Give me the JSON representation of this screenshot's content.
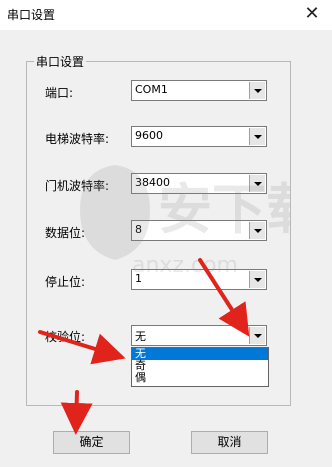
{
  "window": {
    "title": "串口设置",
    "close_glyph": "✕"
  },
  "group": {
    "title": "串口设置"
  },
  "fields": [
    {
      "label": "端口:",
      "value": "COM1"
    },
    {
      "label": "电梯波特率:",
      "value": "9600"
    },
    {
      "label": "门机波特率:",
      "value": "38400"
    },
    {
      "label": "数据位:",
      "value": "8"
    },
    {
      "label": "停止位:",
      "value": "1"
    },
    {
      "label": "校验位:",
      "value": "无"
    }
  ],
  "parity_options": [
    "无",
    "奇",
    "偶"
  ],
  "buttons": {
    "ok": "确定",
    "cancel": "取消"
  },
  "watermark": {
    "text_large": "安下载",
    "text_small": "anxz.com"
  },
  "colors": {
    "arrow": "#e0241c",
    "selection": "#0078d7"
  }
}
